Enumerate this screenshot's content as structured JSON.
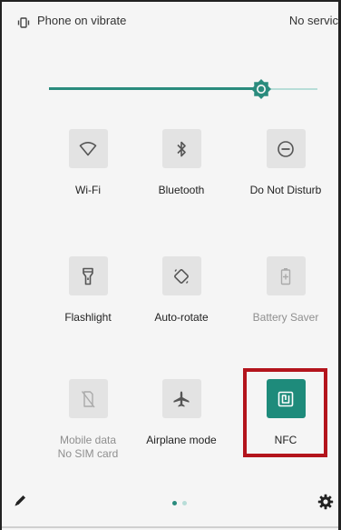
{
  "status": {
    "left_text": "Phone on vibrate",
    "right_text": "No servic"
  },
  "brightness": {
    "level": 0.79,
    "accent": "#2a8b7d",
    "track": "#b8ddd8"
  },
  "tiles": [
    {
      "label": "Wi-Fi",
      "icon": "wifi-icon",
      "state": "off"
    },
    {
      "label": "Bluetooth",
      "icon": "bluetooth-icon",
      "state": "off"
    },
    {
      "label": "Do Not Disturb",
      "icon": "do-not-disturb-icon",
      "state": "off"
    },
    {
      "label": "Flashlight",
      "icon": "flashlight-icon",
      "state": "off"
    },
    {
      "label": "Auto-rotate",
      "icon": "auto-rotate-icon",
      "state": "off"
    },
    {
      "label": "Battery Saver",
      "icon": "battery-saver-icon",
      "state": "unavailable"
    },
    {
      "label": "Mobile data",
      "sublabel": "No SIM card",
      "icon": "mobile-data-off-icon",
      "state": "unavailable"
    },
    {
      "label": "Airplane mode",
      "icon": "airplane-icon",
      "state": "off"
    },
    {
      "label": "NFC",
      "icon": "nfc-icon",
      "state": "on"
    }
  ],
  "highlight": {
    "target": "NFC",
    "color": "#b3141c"
  },
  "pager": {
    "page_count": 2,
    "current_page": 1,
    "active_color": "#2a8b7d",
    "inactive_color": "#b8ddd8"
  },
  "colors": {
    "panel_bg": "#f5f5f5",
    "tile_bg": "#e3e3e3",
    "tile_active_bg": "#1e8b7b"
  }
}
